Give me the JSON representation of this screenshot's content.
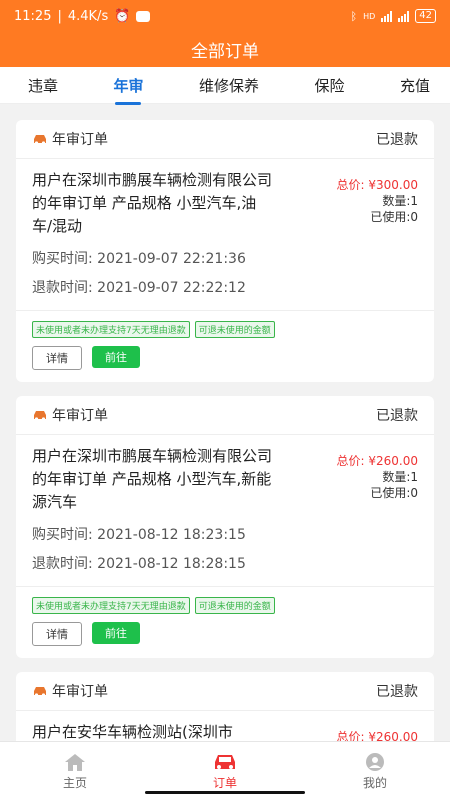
{
  "status": {
    "time": "11:25",
    "speed": "4.4K/s",
    "battery": "42",
    "hd": "HD"
  },
  "header": {
    "title": "全部订单"
  },
  "tabs": [
    {
      "label": "违章"
    },
    {
      "label": "年审"
    },
    {
      "label": "维修保养"
    },
    {
      "label": "保险"
    },
    {
      "label": "充值"
    }
  ],
  "orders": [
    {
      "type": "年审订单",
      "status": "已退款",
      "desc": "用户在深圳市鹏展车辆检测有限公司的年审订单 产品规格 小型汽车,油车/混动",
      "total": "总价: ¥300.00",
      "qty": "数量:1",
      "used": "已使用:0",
      "buy_time": "购买时间:   2021-09-07 22:21:36",
      "refund_time": "退款时间:   2021-09-07 22:22:12"
    },
    {
      "type": "年审订单",
      "status": "已退款",
      "desc": "用户在深圳市鹏展车辆检测有限公司的年审订单 产品规格 小型汽车,新能源汽车",
      "total": "总价: ¥260.00",
      "qty": "数量:1",
      "used": "已使用:0",
      "buy_time": "购买时间:   2021-08-12 18:23:15",
      "refund_time": "退款时间:   2021-08-12 18:28:15"
    },
    {
      "type": "年审订单",
      "status": "已退款",
      "desc": "用户在安华车辆检测站(深圳市",
      "total": "总价: ¥260.00"
    }
  ],
  "tags": {
    "t1": "未使用或者未办理支持7天无理由退款",
    "t2": "可退未使用的金额"
  },
  "buttons": {
    "detail": "详情",
    "go": "前往"
  },
  "bottom_nav": [
    {
      "label": "主页"
    },
    {
      "label": "订单"
    },
    {
      "label": "我的"
    }
  ],
  "colors": {
    "accent": "#ff7a22",
    "tab_active": "#1a73d9",
    "price": "#e33333",
    "green": "#1ec04b"
  }
}
